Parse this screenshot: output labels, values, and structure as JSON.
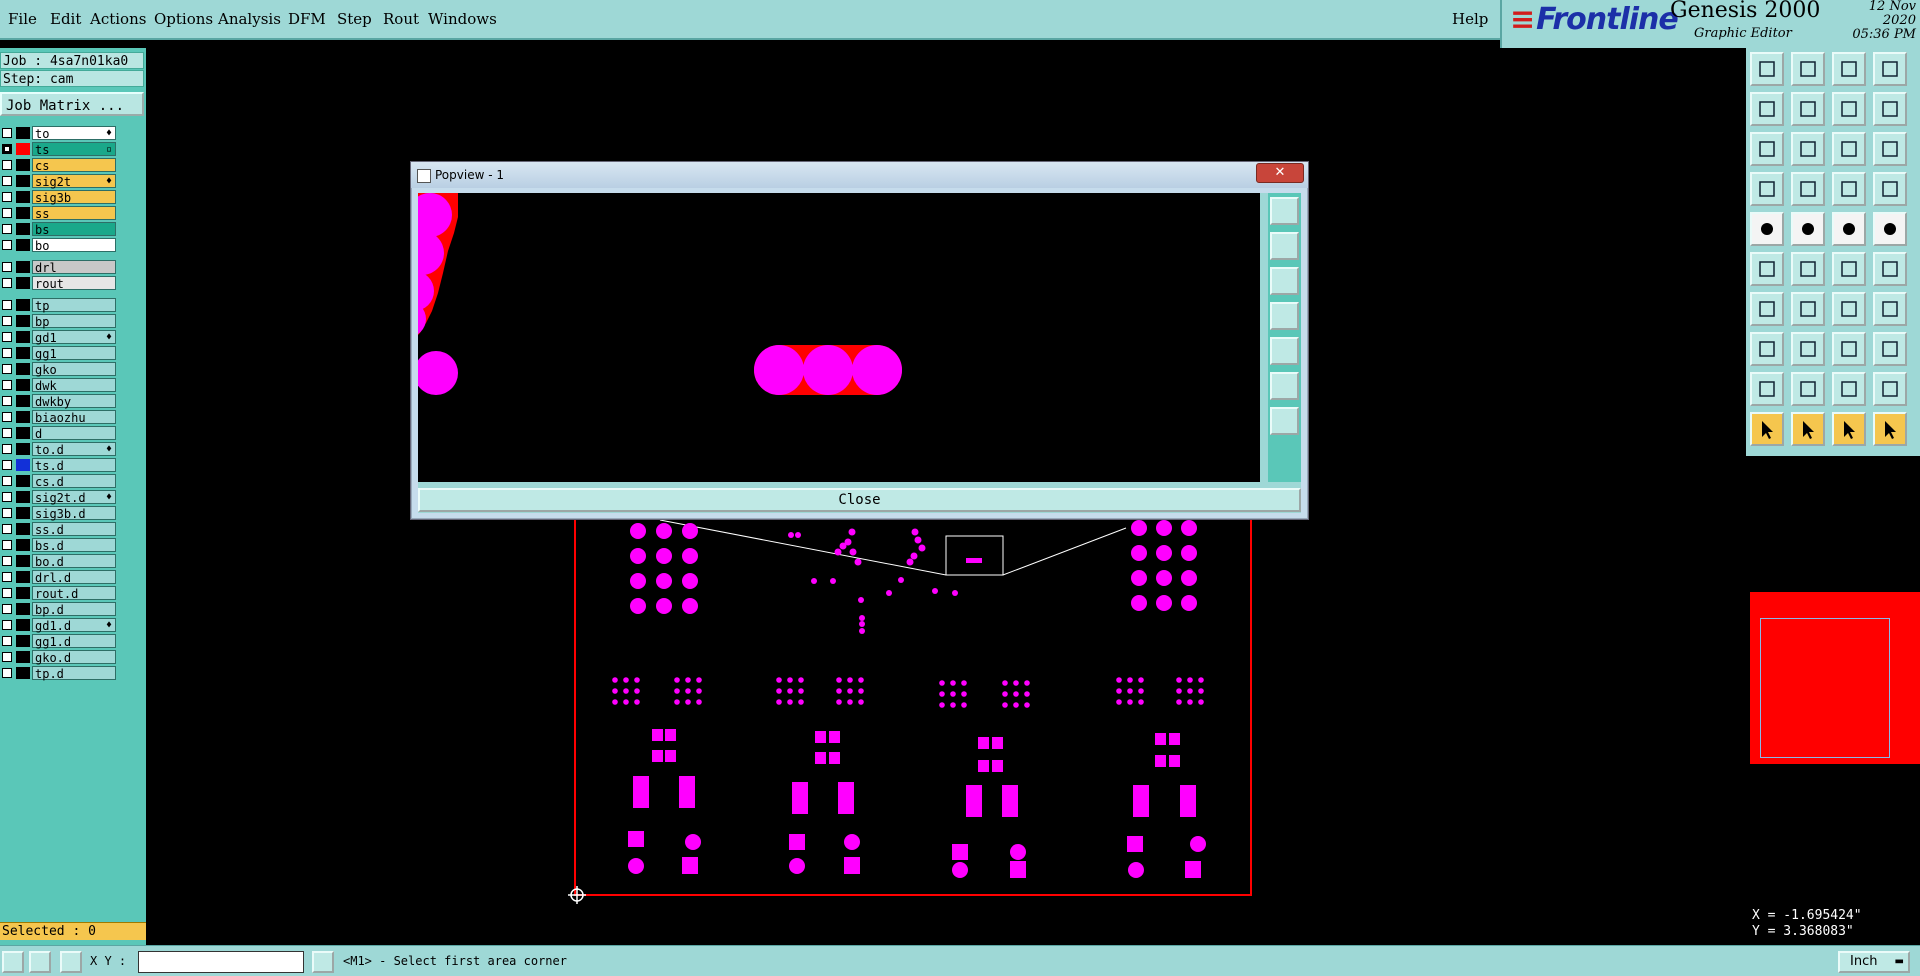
{
  "menu": [
    "File",
    "Edit",
    "Actions",
    "Options",
    "Analysis",
    "DFM",
    "Step",
    "Rout",
    "Windows"
  ],
  "help": "Help",
  "brand": {
    "logo": "Frontline",
    "product": "Genesis 2000",
    "subtitle": "Graphic Editor",
    "date": "12 Nov 2020",
    "time": "05:36 PM"
  },
  "job": {
    "job_line": "Job : 4sa7n01ka0",
    "step_line": "Step: cam",
    "matrix_button": "Job Matrix ..."
  },
  "layers": [
    {
      "name": "to",
      "color": "#ffffff",
      "swatch": "#000000",
      "checked": false,
      "mark": "♦"
    },
    {
      "name": "ts",
      "color": "#1aa88a",
      "swatch": "#ff0000",
      "checked": true,
      "mark": "▫"
    },
    {
      "name": "cs",
      "color": "#f5c64e",
      "swatch": "#000000",
      "checked": false,
      "mark": ""
    },
    {
      "name": "sig2t",
      "color": "#f5c64e",
      "swatch": "#000000",
      "checked": false,
      "mark": "♦"
    },
    {
      "name": "sig3b",
      "color": "#f5c64e",
      "swatch": "#000000",
      "checked": false,
      "mark": ""
    },
    {
      "name": "ss",
      "color": "#f5c64e",
      "swatch": "#000000",
      "checked": false,
      "mark": ""
    },
    {
      "name": "bs",
      "color": "#1aa88a",
      "swatch": "#000000",
      "checked": false,
      "mark": ""
    },
    {
      "name": "bo",
      "color": "#ffffff",
      "swatch": "#000000",
      "checked": false,
      "mark": ""
    },
    {
      "name": "drl",
      "color": "#c8c8c8",
      "swatch": "#000000",
      "checked": false,
      "mark": ""
    },
    {
      "name": "rout",
      "color": "#e6e6e6",
      "swatch": "#000000",
      "checked": false,
      "mark": ""
    },
    {
      "name": "tp",
      "color": "#9ed8d6",
      "swatch": "#000000",
      "checked": false,
      "mark": ""
    },
    {
      "name": "bp",
      "color": "#9ed8d6",
      "swatch": "#000000",
      "checked": false,
      "mark": ""
    },
    {
      "name": "gd1",
      "color": "#9ed8d6",
      "swatch": "#000000",
      "checked": false,
      "mark": "♦"
    },
    {
      "name": "gg1",
      "color": "#9ed8d6",
      "swatch": "#000000",
      "checked": false,
      "mark": ""
    },
    {
      "name": "gko",
      "color": "#9ed8d6",
      "swatch": "#000000",
      "checked": false,
      "mark": ""
    },
    {
      "name": "dwk",
      "color": "#9ed8d6",
      "swatch": "#000000",
      "checked": false,
      "mark": ""
    },
    {
      "name": "dwkby",
      "color": "#9ed8d6",
      "swatch": "#000000",
      "checked": false,
      "mark": ""
    },
    {
      "name": "biaozhu",
      "color": "#9ed8d6",
      "swatch": "#000000",
      "checked": false,
      "mark": ""
    },
    {
      "name": "d",
      "color": "#9ed8d6",
      "swatch": "#000000",
      "checked": false,
      "mark": ""
    },
    {
      "name": "to.d",
      "color": "#9ed8d6",
      "swatch": "#000000",
      "checked": false,
      "mark": "♦"
    },
    {
      "name": "ts.d",
      "color": "#9ed8d6",
      "swatch": "#1230d8",
      "checked": false,
      "mark": ""
    },
    {
      "name": "cs.d",
      "color": "#9ed8d6",
      "swatch": "#000000",
      "checked": false,
      "mark": ""
    },
    {
      "name": "sig2t.d",
      "color": "#9ed8d6",
      "swatch": "#000000",
      "checked": false,
      "mark": "♦"
    },
    {
      "name": "sig3b.d",
      "color": "#9ed8d6",
      "swatch": "#000000",
      "checked": false,
      "mark": ""
    },
    {
      "name": "ss.d",
      "color": "#9ed8d6",
      "swatch": "#000000",
      "checked": false,
      "mark": ""
    },
    {
      "name": "bs.d",
      "color": "#9ed8d6",
      "swatch": "#000000",
      "checked": false,
      "mark": ""
    },
    {
      "name": "bo.d",
      "color": "#9ed8d6",
      "swatch": "#000000",
      "checked": false,
      "mark": ""
    },
    {
      "name": "drl.d",
      "color": "#9ed8d6",
      "swatch": "#000000",
      "checked": false,
      "mark": ""
    },
    {
      "name": "rout.d",
      "color": "#9ed8d6",
      "swatch": "#000000",
      "checked": false,
      "mark": ""
    },
    {
      "name": "bp.d",
      "color": "#9ed8d6",
      "swatch": "#000000",
      "checked": false,
      "mark": ""
    },
    {
      "name": "gd1.d",
      "color": "#9ed8d6",
      "swatch": "#000000",
      "checked": false,
      "mark": "♦"
    },
    {
      "name": "gg1.d",
      "color": "#9ed8d6",
      "swatch": "#000000",
      "checked": false,
      "mark": ""
    },
    {
      "name": "gko.d",
      "color": "#9ed8d6",
      "swatch": "#000000",
      "checked": false,
      "mark": ""
    },
    {
      "name": "tp.d",
      "color": "#9ed8d6",
      "swatch": "#000000",
      "checked": false,
      "mark": ""
    }
  ],
  "selected": "Selected : 0",
  "coords": {
    "x": "X = -1.695424\"",
    "y": "Y = 3.368083\""
  },
  "status": {
    "xy_label": "X Y :",
    "xy_value": "",
    "prompt": "<M1> - Select first area corner",
    "unit": "Inch"
  },
  "popview": {
    "title": "Popview - 1",
    "close": "Close"
  },
  "colors": {
    "panel": "#9ed8d6",
    "panel_dark": "#5ac7b8",
    "pad": "#ff00ff",
    "outline": "#ff0000",
    "highlight": "#f5c64e"
  },
  "tool_icons": [
    "open-job-icon",
    "save-icon",
    "home-icon",
    "window-icon",
    "import-icon",
    "export-icon",
    "align-icon",
    "snake-icon",
    "zoom-fit-icon",
    "zoom-page-icon",
    "scale-1-2-icon",
    "help-icon",
    "settings-icon",
    "grid-icon",
    "layers-color-icon",
    "layers-icon",
    "pad-icon",
    "line-icon",
    "surface-icon",
    "hole-icon",
    "netlist-icon",
    "cross-icon",
    "connect-icon",
    "route-icon",
    "measure-icon",
    "slash-icon",
    "arc-icon",
    "font-icon",
    "snap-icon",
    "minus-icon",
    "center-icon",
    "select-box-icon",
    "triangle-icon",
    "text-a-icon",
    "text-a2-icon",
    "angle-icon",
    "pointer-icon",
    "pointer-select-icon",
    "pointer-active-icon",
    "pointer-move-icon"
  ]
}
